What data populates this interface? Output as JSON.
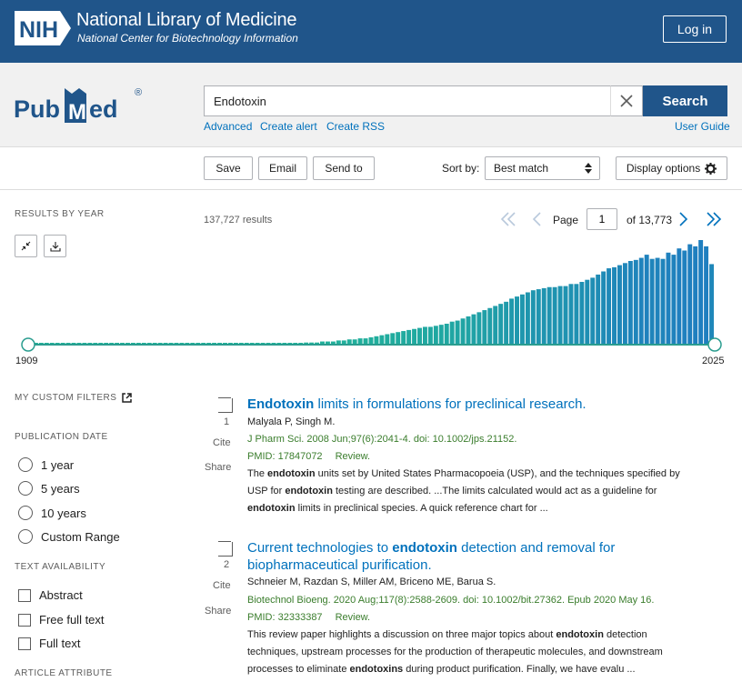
{
  "header": {
    "logo_text": "NIH",
    "title": "National Library of Medicine",
    "subtitle": "National Center for Biotechnology Information",
    "login_label": "Log in"
  },
  "search": {
    "logo_text": "PubMed",
    "query": "Endotoxin",
    "search_label": "Search",
    "links": [
      "Advanced",
      "Create alert",
      "Create RSS"
    ],
    "user_guide": "User Guide"
  },
  "toolbar": {
    "save": "Save",
    "email": "Email",
    "send_to": "Send to",
    "sort_by_label": "Sort by:",
    "sort_value": "Best match",
    "display_options": "Display options"
  },
  "results_by_year": {
    "label": "RESULTS BY YEAR",
    "count_text": "137,727 results",
    "start_year": "1909",
    "end_year": "2025",
    "bar_color_old": "#20b29a",
    "bar_color_recent": "#1f7fbf"
  },
  "pager": {
    "page_label": "Page",
    "page_value": "1",
    "of_text": "of 13,773"
  },
  "chart_data": {
    "type": "bar",
    "x": "year",
    "ylabel": "",
    "values_relative": [
      0.01,
      0.01,
      0.01,
      0.01,
      0.01,
      0.01,
      0.01,
      0.01,
      0.01,
      0.01,
      0.01,
      0.01,
      0.01,
      0.01,
      0.01,
      0.01,
      0.01,
      0.01,
      0.01,
      0.01,
      0.01,
      0.01,
      0.01,
      0.01,
      0.01,
      0.01,
      0.01,
      0.01,
      0.01,
      0.01,
      0.01,
      0.01,
      0.01,
      0.01,
      0.01,
      0.01,
      0.01,
      0.01,
      0.01,
      0.01,
      0.01,
      0.01,
      0.01,
      0.01,
      0.01,
      0.01,
      0.01,
      0.01,
      0.01,
      0.01,
      0.01,
      0.02,
      0.02,
      0.02,
      0.03,
      0.03,
      0.03,
      0.04,
      0.04,
      0.05,
      0.05,
      0.06,
      0.06,
      0.07,
      0.08,
      0.09,
      0.1,
      0.11,
      0.12,
      0.13,
      0.14,
      0.15,
      0.16,
      0.17,
      0.17,
      0.18,
      0.19,
      0.2,
      0.22,
      0.23,
      0.25,
      0.27,
      0.29,
      0.31,
      0.33,
      0.35,
      0.37,
      0.39,
      0.41,
      0.44,
      0.46,
      0.48,
      0.5,
      0.52,
      0.53,
      0.54,
      0.55,
      0.55,
      0.56,
      0.56,
      0.58,
      0.58,
      0.6,
      0.62,
      0.64,
      0.67,
      0.7,
      0.73,
      0.74,
      0.76,
      0.78,
      0.8,
      0.81,
      0.83,
      0.86,
      0.82,
      0.83,
      0.82,
      0.88,
      0.86,
      0.92,
      0.9,
      0.96,
      0.94,
      1.0,
      0.94,
      0.77
    ]
  },
  "sidebar": {
    "custom_filters": "MY CUSTOM FILTERS",
    "pub_date": "PUBLICATION DATE",
    "date_options": [
      "1 year",
      "5 years",
      "10 years",
      "Custom Range"
    ],
    "text_avail": "TEXT AVAILABILITY",
    "text_options": [
      "Abstract",
      "Free full text",
      "Full text"
    ],
    "article_attr": "ARTICLE ATTRIBUTE"
  },
  "results": [
    {
      "num": "1",
      "title_bold": "Endotoxin",
      "title_rest": " limits in formulations for preclinical research.",
      "authors": "Malyala P, Singh M.",
      "citation": "J Pharm Sci. 2008 Jun;97(6):2041-4. doi: 10.1002/jps.21152.",
      "pmid": "PMID: 17847072",
      "type": "Review.",
      "cite": "Cite",
      "share": "Share",
      "snippet": [
        [
          "The ",
          "endotoxin",
          " units set by United States Pharmacopoeia (USP), and the techniques specified by"
        ],
        [
          "USP for ",
          "endotoxin",
          " testing are described. ...The limits calculated would act as a guideline for"
        ],
        [
          "",
          "endotoxin",
          " limits in preclinical species. A quick reference chart for ..."
        ]
      ]
    },
    {
      "num": "2",
      "title_line1_pre": "Current technologies to ",
      "title_bold": "endotoxin",
      "title_line1_post": " detection and removal for",
      "title_line2": "biopharmaceutical purification.",
      "authors": "Schneier M, Razdan S, Miller AM, Briceno ME, Barua S.",
      "citation": "Biotechnol Bioeng. 2020 Aug;117(8):2588-2609. doi: 10.1002/bit.27362. Epub 2020 May 16.",
      "pmid": "PMID: 32333387",
      "type": "Review.",
      "cite": "Cite",
      "share": "Share",
      "snippet": [
        [
          "This review paper highlights a discussion on three major topics about ",
          "endotoxin",
          " detection"
        ],
        [
          "techniques, upstream processes for the production of therapeutic molecules, and downstream",
          "",
          ""
        ],
        [
          "processes to eliminate ",
          "endotoxins",
          " during product purification. Finally, we have evalu ..."
        ]
      ]
    }
  ]
}
